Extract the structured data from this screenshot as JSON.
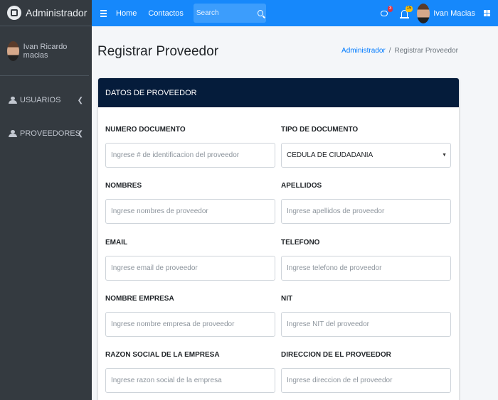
{
  "brand": {
    "title": "Administrador"
  },
  "user_panel": {
    "name": "Ivan Ricardo macias"
  },
  "sidebar": {
    "items": [
      {
        "label": "USUARIOS"
      },
      {
        "label": "PROVEEDORES"
      }
    ]
  },
  "topbar": {
    "links": [
      {
        "label": "Home"
      },
      {
        "label": "Contactos"
      }
    ],
    "search_placeholder": "Search",
    "messages_badge": "3",
    "notifications_badge": "15",
    "user_name": "Ivan Macias"
  },
  "page": {
    "title": "Registrar Proveedor"
  },
  "breadcrumb": {
    "parent": "Administrador",
    "current": "Registrar Proveedor"
  },
  "card": {
    "title": "DATOS DE PROVEEDOR",
    "fields": {
      "numero_documento": {
        "label": "NUMERO DOCUMENTO",
        "placeholder": "Ingrese # de identificacion del proveedor"
      },
      "tipo_documento": {
        "label": "TIPO DE DOCUMENTO",
        "value": "CEDULA DE CIUDADANIA"
      },
      "nombres": {
        "label": "NOMBRES",
        "placeholder": "Ingrese nombres de proveedor"
      },
      "apellidos": {
        "label": "APELLIDOS",
        "placeholder": "Ingrese apellidos de proveedor"
      },
      "email": {
        "label": "EMAIL",
        "placeholder": "Ingrese email de proveedor"
      },
      "telefono": {
        "label": "TELEFONO",
        "placeholder": "Ingrese telefono de proveedor"
      },
      "nombre_empresa": {
        "label": "NOMBRE EMPRESA",
        "placeholder": "Ingrese nombre empresa de proveedor"
      },
      "nit": {
        "label": "NIT",
        "placeholder": "Ingrese NIT del proveedor"
      },
      "razon_social": {
        "label": "RAZON SOCIAL DE LA EMPRESA",
        "placeholder": "Ingrese razon social de la empresa"
      },
      "direccion": {
        "label": "DIRECCION DE EL PROVEEDOR",
        "placeholder": "Ingrese direccion de el proveedor"
      }
    }
  },
  "colors": {
    "sidebar": "#343a40",
    "topbar": "#1688fb",
    "card_header": "#051c3b",
    "link": "#007bff"
  }
}
